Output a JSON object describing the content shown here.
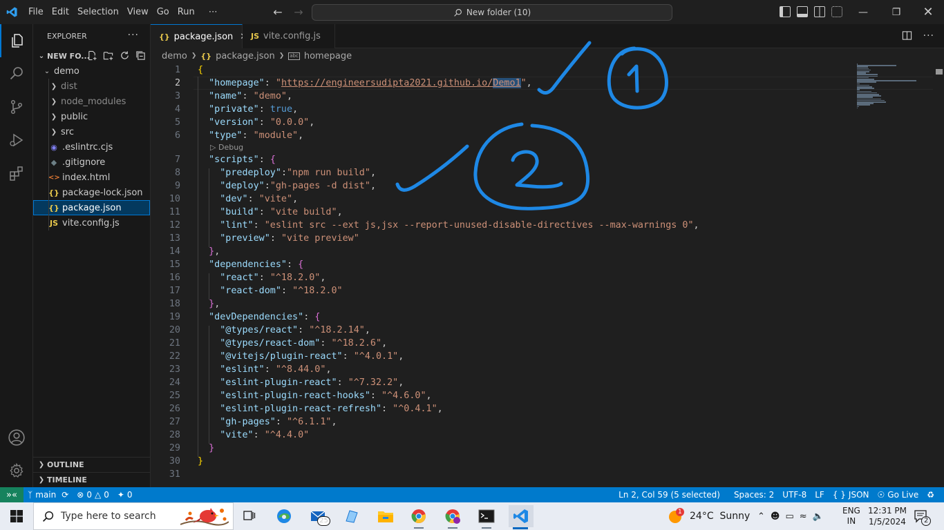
{
  "titlebar": {
    "menus": [
      "File",
      "Edit",
      "Selection",
      "View",
      "Go",
      "Run",
      "⋯"
    ],
    "command_center": "New folder (10)"
  },
  "explorer": {
    "title": "EXPLORER",
    "folder_title": "NEW FO...",
    "items": [
      {
        "label": "demo",
        "type": "folder-open",
        "depth": 0
      },
      {
        "label": "dist",
        "type": "folder",
        "depth": 1,
        "dim": true
      },
      {
        "label": "node_modules",
        "type": "folder",
        "depth": 1,
        "dim": true
      },
      {
        "label": "public",
        "type": "folder",
        "depth": 1
      },
      {
        "label": "src",
        "type": "folder",
        "depth": 1
      },
      {
        "label": ".eslintrc.cjs",
        "type": "eslint",
        "depth": 1
      },
      {
        "label": ".gitignore",
        "type": "git",
        "depth": 1
      },
      {
        "label": "index.html",
        "type": "html",
        "depth": 1
      },
      {
        "label": "package-lock.json",
        "type": "json",
        "depth": 1
      },
      {
        "label": "package.json",
        "type": "json",
        "depth": 1,
        "selected": true
      },
      {
        "label": "vite.config.js",
        "type": "js",
        "depth": 1
      }
    ],
    "outline": "OUTLINE",
    "timeline": "TIMELINE"
  },
  "tabs": [
    {
      "label": "package.json",
      "icon": "{}",
      "active": true
    },
    {
      "label": "vite.config.js",
      "icon": "JS",
      "active": false
    }
  ],
  "breadcrumb": [
    "demo",
    "package.json",
    "homepage"
  ],
  "codelens": "Debug",
  "code": [
    [
      [
        "b1",
        "{"
      ]
    ],
    [
      [
        "p",
        "  "
      ],
      [
        "k",
        "\"homepage\""
      ],
      [
        "p",
        ": "
      ],
      [
        "s",
        "\""
      ],
      [
        "sl",
        "https://engineersudipta2021.github.io/"
      ],
      [
        "ss",
        "Demo1"
      ],
      [
        "s",
        "\""
      ],
      [
        "p",
        ","
      ]
    ],
    [
      [
        "p",
        "  "
      ],
      [
        "k",
        "\"name\""
      ],
      [
        "p",
        ": "
      ],
      [
        "s",
        "\"demo\""
      ],
      [
        "p",
        ","
      ]
    ],
    [
      [
        "p",
        "  "
      ],
      [
        "k",
        "\"private\""
      ],
      [
        "p",
        ": "
      ],
      [
        "kw",
        "true"
      ],
      [
        "p",
        ","
      ]
    ],
    [
      [
        "p",
        "  "
      ],
      [
        "k",
        "\"version\""
      ],
      [
        "p",
        ": "
      ],
      [
        "s",
        "\"0.0.0\""
      ],
      [
        "p",
        ","
      ]
    ],
    [
      [
        "p",
        "  "
      ],
      [
        "k",
        "\"type\""
      ],
      [
        "p",
        ": "
      ],
      [
        "s",
        "\"module\""
      ],
      [
        "p",
        ","
      ]
    ],
    [
      [
        "p",
        "  "
      ],
      [
        "k",
        "\"scripts\""
      ],
      [
        "p",
        ": "
      ],
      [
        "b2",
        "{"
      ]
    ],
    [
      [
        "p",
        "    "
      ],
      [
        "k",
        "\"predeploy\""
      ],
      [
        "p",
        ":"
      ],
      [
        "s",
        "\"npm run build\""
      ],
      [
        "p",
        ","
      ]
    ],
    [
      [
        "p",
        "    "
      ],
      [
        "k",
        "\"deploy\""
      ],
      [
        "p",
        ":"
      ],
      [
        "s",
        "\"gh-pages -d dist\""
      ],
      [
        "p",
        ","
      ]
    ],
    [
      [
        "p",
        "    "
      ],
      [
        "k",
        "\"dev\""
      ],
      [
        "p",
        ": "
      ],
      [
        "s",
        "\"vite\""
      ],
      [
        "p",
        ","
      ]
    ],
    [
      [
        "p",
        "    "
      ],
      [
        "k",
        "\"build\""
      ],
      [
        "p",
        ": "
      ],
      [
        "s",
        "\"vite build\""
      ],
      [
        "p",
        ","
      ]
    ],
    [
      [
        "p",
        "    "
      ],
      [
        "k",
        "\"lint\""
      ],
      [
        "p",
        ": "
      ],
      [
        "s",
        "\"eslint src --ext js,jsx --report-unused-disable-directives --max-warnings 0\""
      ],
      [
        "p",
        ","
      ]
    ],
    [
      [
        "p",
        "    "
      ],
      [
        "k",
        "\"preview\""
      ],
      [
        "p",
        ": "
      ],
      [
        "s",
        "\"vite preview\""
      ]
    ],
    [
      [
        "p",
        "  "
      ],
      [
        "b2",
        "}"
      ],
      [
        "p",
        ","
      ]
    ],
    [
      [
        "p",
        "  "
      ],
      [
        "k",
        "\"dependencies\""
      ],
      [
        "p",
        ": "
      ],
      [
        "b2",
        "{"
      ]
    ],
    [
      [
        "p",
        "    "
      ],
      [
        "k",
        "\"react\""
      ],
      [
        "p",
        ": "
      ],
      [
        "s",
        "\"^18.2.0\""
      ],
      [
        "p",
        ","
      ]
    ],
    [
      [
        "p",
        "    "
      ],
      [
        "k",
        "\"react-dom\""
      ],
      [
        "p",
        ": "
      ],
      [
        "s",
        "\"^18.2.0\""
      ]
    ],
    [
      [
        "p",
        "  "
      ],
      [
        "b2",
        "}"
      ],
      [
        "p",
        ","
      ]
    ],
    [
      [
        "p",
        "  "
      ],
      [
        "k",
        "\"devDependencies\""
      ],
      [
        "p",
        ": "
      ],
      [
        "b2",
        "{"
      ]
    ],
    [
      [
        "p",
        "    "
      ],
      [
        "k",
        "\"@types/react\""
      ],
      [
        "p",
        ": "
      ],
      [
        "s",
        "\"^18.2.14\""
      ],
      [
        "p",
        ","
      ]
    ],
    [
      [
        "p",
        "    "
      ],
      [
        "k",
        "\"@types/react-dom\""
      ],
      [
        "p",
        ": "
      ],
      [
        "s",
        "\"^18.2.6\""
      ],
      [
        "p",
        ","
      ]
    ],
    [
      [
        "p",
        "    "
      ],
      [
        "k",
        "\"@vitejs/plugin-react\""
      ],
      [
        "p",
        ": "
      ],
      [
        "s",
        "\"^4.0.1\""
      ],
      [
        "p",
        ","
      ]
    ],
    [
      [
        "p",
        "    "
      ],
      [
        "k",
        "\"eslint\""
      ],
      [
        "p",
        ": "
      ],
      [
        "s",
        "\"^8.44.0\""
      ],
      [
        "p",
        ","
      ]
    ],
    [
      [
        "p",
        "    "
      ],
      [
        "k",
        "\"eslint-plugin-react\""
      ],
      [
        "p",
        ": "
      ],
      [
        "s",
        "\"^7.32.2\""
      ],
      [
        "p",
        ","
      ]
    ],
    [
      [
        "p",
        "    "
      ],
      [
        "k",
        "\"eslint-plugin-react-hooks\""
      ],
      [
        "p",
        ": "
      ],
      [
        "s",
        "\"^4.6.0\""
      ],
      [
        "p",
        ","
      ]
    ],
    [
      [
        "p",
        "    "
      ],
      [
        "k",
        "\"eslint-plugin-react-refresh\""
      ],
      [
        "p",
        ": "
      ],
      [
        "s",
        "\"^0.4.1\""
      ],
      [
        "p",
        ","
      ]
    ],
    [
      [
        "p",
        "    "
      ],
      [
        "k",
        "\"gh-pages\""
      ],
      [
        "p",
        ": "
      ],
      [
        "s",
        "\"^6.1.1\""
      ],
      [
        "p",
        ","
      ]
    ],
    [
      [
        "p",
        "    "
      ],
      [
        "k",
        "\"vite\""
      ],
      [
        "p",
        ": "
      ],
      [
        "s",
        "\"^4.4.0\""
      ]
    ],
    [
      [
        "p",
        "  "
      ],
      [
        "b2",
        "}"
      ]
    ],
    [
      [
        "b1",
        "}"
      ]
    ],
    []
  ],
  "annotations": {
    "one": "1",
    "two": "2"
  },
  "statusbar": {
    "branch": "main",
    "errors": "0",
    "warnings": "0",
    "ports": "0",
    "position": "Ln 2, Col 59 (5 selected)",
    "spaces": "Spaces: 2",
    "encoding": "UTF-8",
    "eol": "LF",
    "language": "JSON",
    "golive": "Go Live"
  },
  "taskbar": {
    "search_placeholder": "Type here to search",
    "mail_badge": "25",
    "weather": "24°C  Sunny",
    "weather_badge": "1",
    "lang1": "ENG",
    "lang2": "IN",
    "time": "12:31 PM",
    "date": "1/5/2024",
    "notif_count": "2"
  },
  "colors": {
    "accent": "#007acc",
    "selection": "#04395e",
    "string": "#ce9178",
    "key": "#9cdcfe",
    "annotation": "#1e88e5"
  }
}
